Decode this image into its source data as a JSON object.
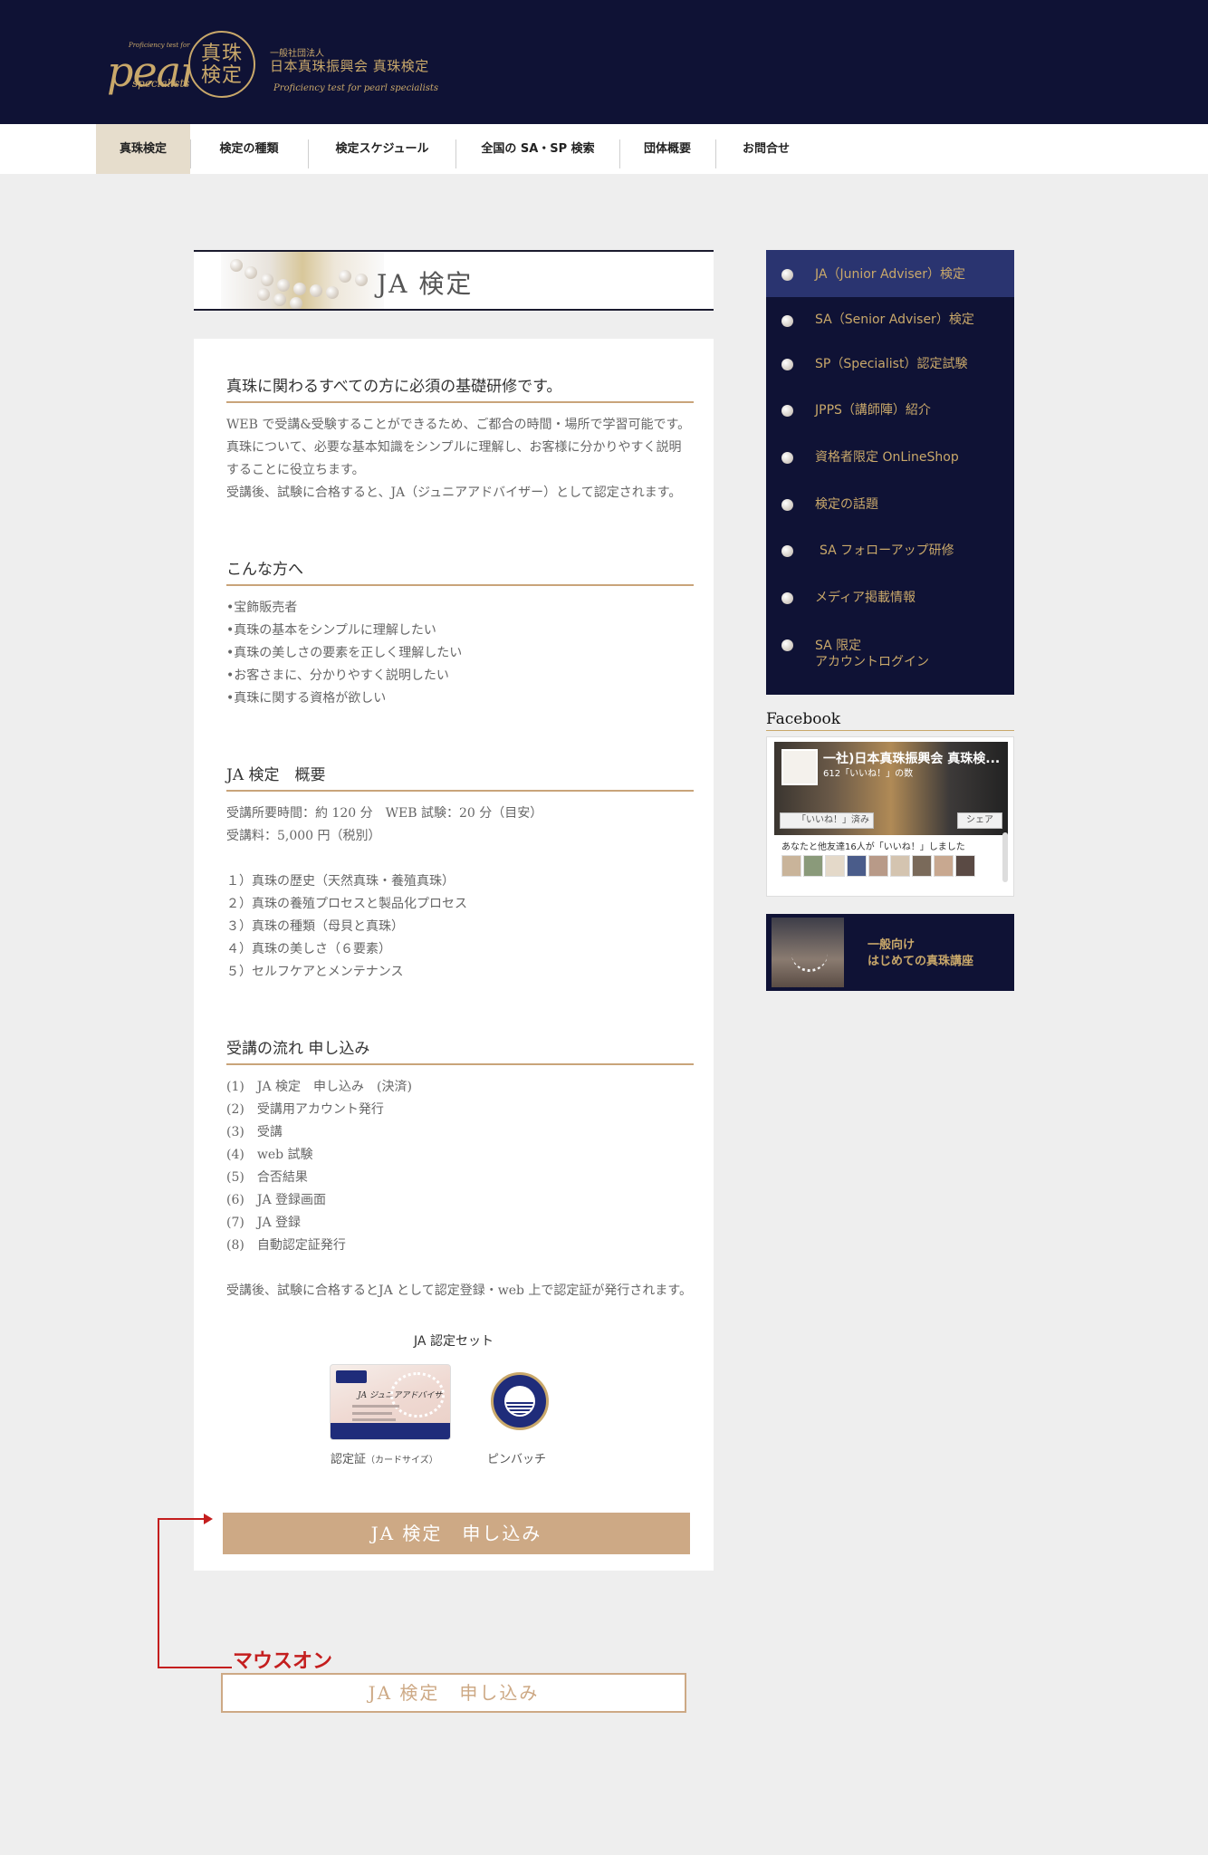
{
  "header": {
    "logo_small_en": "Proficiency test for",
    "logo_script": "pearl",
    "logo_specialists": "specialists",
    "logo_seal": "真珠\n検定",
    "org_small": "一般社団法人",
    "org_name": "日本真珠振興会 真珠検定",
    "org_en": "Proficiency test for pearl specialists"
  },
  "nav": {
    "items": [
      {
        "label": "真珠検定"
      },
      {
        "label": "検定の種類"
      },
      {
        "label": "検定スケジュール"
      },
      {
        "label": "全国の SA・SP 検索"
      },
      {
        "label": "団体概要"
      },
      {
        "label": "お問合せ"
      }
    ]
  },
  "main": {
    "page_title": "JA 検定",
    "sections": [
      {
        "title": "真珠に関わるすべての方に必須の基礎研修です。",
        "lines": [
          "WEB で受講&受験することができるため、ご都合の時間・場所で学習可能です。",
          "真珠について、必要な基本知識をシンプルに理解し、お客様に分かりやすく説明",
          "することに役立ちます。",
          "受講後、試験に合格すると、JA（ジュニアアドバイザー）として認定されます。"
        ]
      },
      {
        "title": "こんな方へ",
        "lines": [
          "•宝飾販売者",
          "•真珠の基本をシンプルに理解したい",
          "•真珠の美しさの要素を正しく理解したい",
          "•お客さまに、分かりやすく説明したい",
          "•真珠に関する資格が欲しい"
        ]
      },
      {
        "title": "JA 検定　概要",
        "lines": [
          "受講所要時間：約 120 分　WEB 試験：20 分（目安）",
          "受講料：5,000 円（税別）",
          "",
          "１）真珠の歴史（天然真珠・養殖真珠）",
          "２）真珠の養殖プロセスと製品化プロセス",
          "３）真珠の種類（母貝と真珠）",
          "４）真珠の美しさ（６要素）",
          "５）セルフケアとメンテナンス"
        ]
      },
      {
        "title": "受講の流れ 申し込み",
        "lines": [
          "(1)　JA 検定　申し込み　(決済)",
          "(2)　受講用アカウント発行",
          "(3)　受講",
          "(4)　web 試験",
          "(5)　合否結果",
          "(6)　JA 登録画面",
          "(7)　JA 登録",
          "(8)　自動認定証発行",
          "",
          "受講後、試験に合格するとJA として認定登録・web 上で認定証が発行されます。"
        ]
      }
    ],
    "set_title": "JA 認定セット",
    "card_caption": "認定証",
    "card_caption_small": "（カードサイズ）",
    "badge_caption": "ピンバッチ",
    "apply_label": "JA 検定　申し込み"
  },
  "sidebar": {
    "items": [
      {
        "label": "JA（Junior Adviser）検定"
      },
      {
        "label": "SA（Senior Adviser）検定"
      },
      {
        "label": "SP（Specialist）認定試験"
      },
      {
        "label": "JPPS（講師陣）紹介"
      },
      {
        "label": "資格者限定 OnLineShop"
      },
      {
        "label": "検定の話題"
      },
      {
        "label": "SA フォローアップ研修"
      },
      {
        "label": "メディア掲載情報"
      },
      {
        "label": "SA 限定\nアカウントログイン"
      }
    ],
    "facebook_label": "Facebook",
    "fb_title": "一社)日本真珠振興会 真珠検...",
    "fb_likes": "612「いいね！」の数",
    "fb_like_btn": "「いいね！」済み",
    "fb_share": "シェア",
    "fb_friends": "あなたと他友達16人が「いいね！」しました",
    "course_banner": "一般向け\nはじめての真珠講座"
  },
  "annotation": {
    "label": "マウスオン",
    "hover_label": "JA 検定　申し込み"
  },
  "colors": {
    "header_bg": "#0f1235",
    "gold": "#c9a86a",
    "button": "#cda985",
    "active_nav": "#e6ddcc",
    "annotation_red": "#c41e1e"
  }
}
